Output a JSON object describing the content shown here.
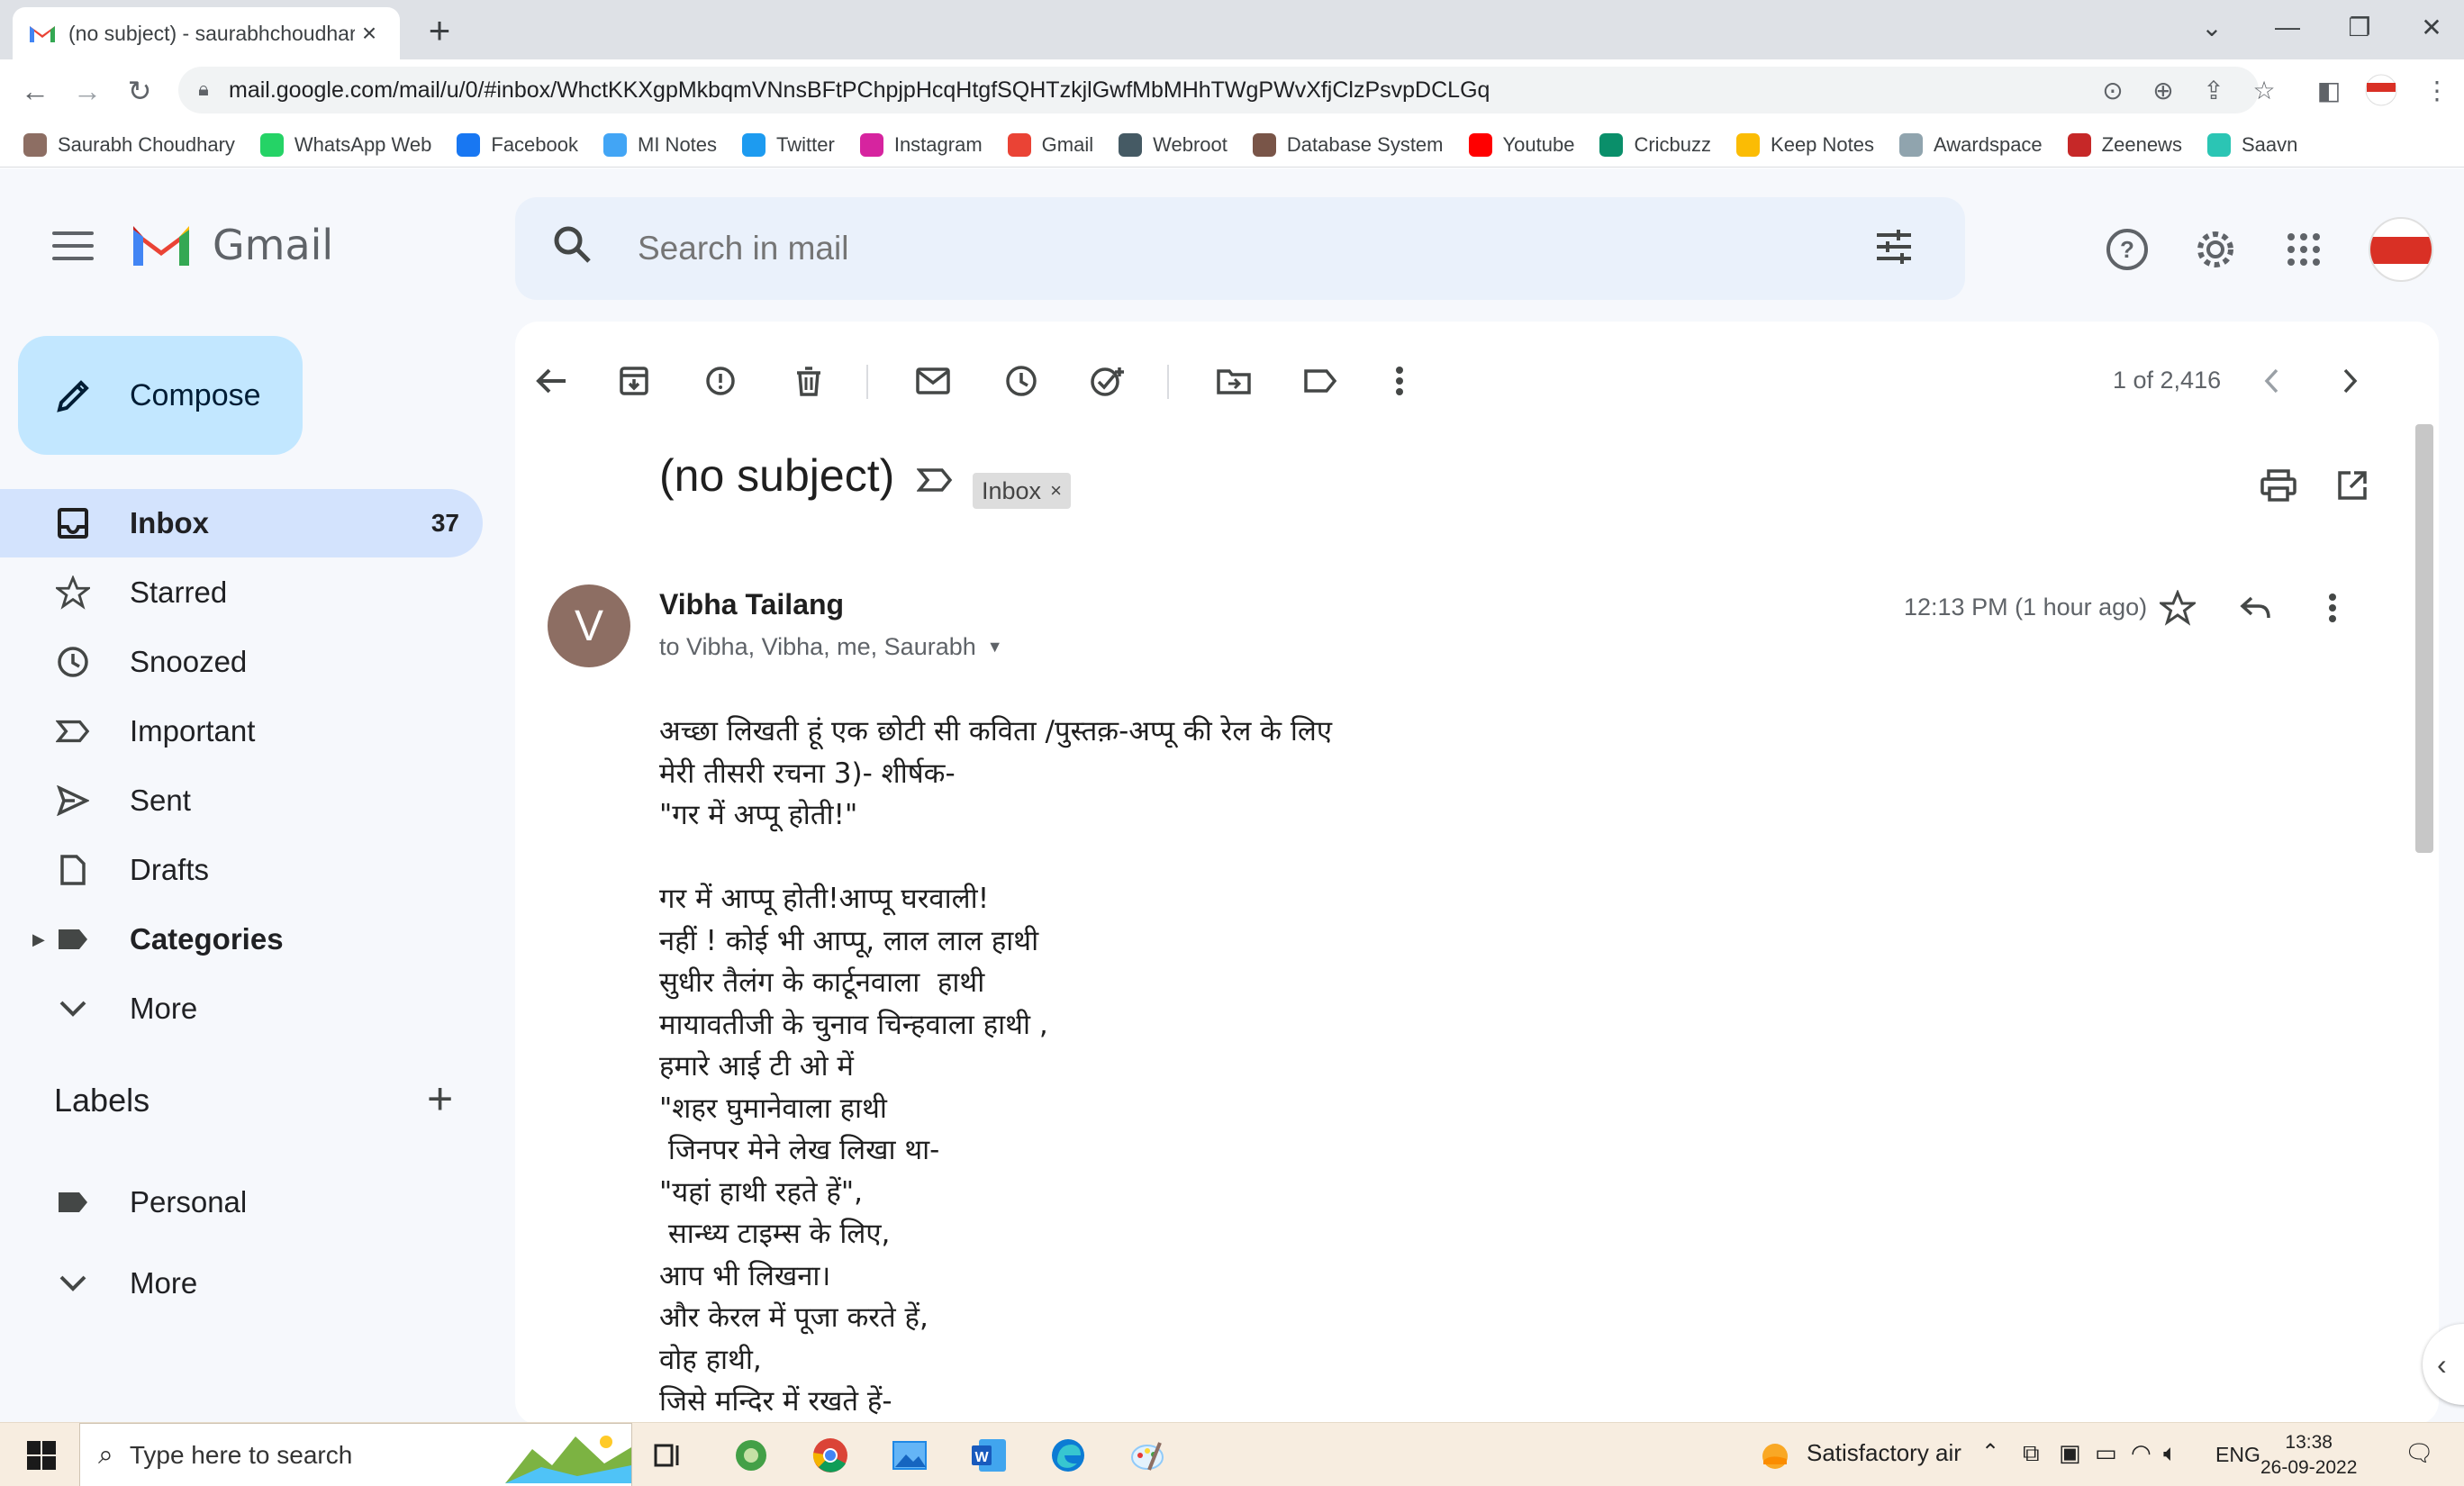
{
  "browser": {
    "tab_title": "(no subject) - saurabhchoudhary",
    "tab_close": "×",
    "new_tab": "+",
    "window_controls": {
      "tabs_menu": "⌄",
      "minimize": "—",
      "restore": "❐",
      "close": "✕"
    },
    "url": "mail.google.com/mail/u/0/#inbox/WhctKKXgpMkbqmVNnsBFtPChpjpHcqHtgfSQHTzkjlGwfMbMHhTWgPWvXfjClzPsvpDCLGq",
    "bookmarks": [
      {
        "label": "Saurabh Choudhary",
        "icon": "profile-icon",
        "color": "#8d6e63"
      },
      {
        "label": "WhatsApp Web",
        "icon": "whatsapp-icon",
        "color": "#25d366"
      },
      {
        "label": "Facebook",
        "icon": "facebook-icon",
        "color": "#1877f2"
      },
      {
        "label": "MI Notes",
        "icon": "notes-icon",
        "color": "#42a5f5"
      },
      {
        "label": "Twitter",
        "icon": "twitter-icon",
        "color": "#1d9bf0"
      },
      {
        "label": "Instagram",
        "icon": "instagram-icon",
        "color": "#d6249f"
      },
      {
        "label": "Gmail",
        "icon": "gmail-icon",
        "color": "#ea4335"
      },
      {
        "label": "Webroot",
        "icon": "webroot-icon",
        "color": "#455a64"
      },
      {
        "label": "Database System",
        "icon": "database-icon",
        "color": "#795548"
      },
      {
        "label": "Youtube",
        "icon": "youtube-icon",
        "color": "#ff0000"
      },
      {
        "label": "Cricbuzz",
        "icon": "cricbuzz-icon",
        "color": "#0a8f6a"
      },
      {
        "label": "Keep Notes",
        "icon": "keep-icon",
        "color": "#fbbc04"
      },
      {
        "label": "Awardspace",
        "icon": "awardspace-icon",
        "color": "#90a4ae"
      },
      {
        "label": "Zeenews",
        "icon": "zeenews-icon",
        "color": "#c62828"
      },
      {
        "label": "Saavn",
        "icon": "saavn-icon",
        "color": "#2bc5b4"
      }
    ]
  },
  "gmail": {
    "brand": "Gmail",
    "search_placeholder": "Search in mail",
    "compose_label": "Compose",
    "nav": [
      {
        "label": "Inbox",
        "count": "37",
        "icon": "inbox-icon",
        "active": true
      },
      {
        "label": "Starred",
        "count": "",
        "icon": "star-icon"
      },
      {
        "label": "Snoozed",
        "count": "",
        "icon": "clock-icon"
      },
      {
        "label": "Important",
        "count": "",
        "icon": "important-icon"
      },
      {
        "label": "Sent",
        "count": "",
        "icon": "send-icon"
      },
      {
        "label": "Drafts",
        "count": "",
        "icon": "draft-icon"
      },
      {
        "label": "Categories",
        "count": "",
        "icon": "label-icon"
      },
      {
        "label": "More",
        "count": "",
        "icon": "chevron-down-icon"
      }
    ],
    "labels_heading": "Labels",
    "labels": [
      {
        "label": "Personal",
        "icon": "label-icon"
      },
      {
        "label": "More",
        "icon": "chevron-down-icon"
      }
    ],
    "pager": "1 of 2,416",
    "message": {
      "subject": "(no subject)",
      "chip": "Inbox",
      "chip_remove": "×",
      "avatar_letter": "V",
      "sender": "Vibha Tailang",
      "recipients": "to Vibha, Vibha, me, Saurabh",
      "time": "12:13 PM (1 hour ago)",
      "body": "अच्छा लिखती हूं एक छोटी सी कविता /पुस्तक़-अप्पू की रेल के लिए\nमेरी तीसरी रचना 3)- शीर्षक-\n\"गर में अप्पू होती!\"\n\nगर में आप्पू होती!आप्पू घरवाली!\nनहीं ! कोई भी आप्पू, लाल लाल हाथी\nसुधीर तैलंग के कार्टूनवाला  हाथी\nमायावतीजी के चुनाव चिन्हवाला हाथी ,\nहमारे आई टी ओ में\n\"शहर घुमानेवाला हाथी\n जिनपर मेने लेख लिखा था-\n\"यहां हाथी रहते हें\",\n सान्ध्य टाइम्स के लिए,\nआप भी लिखना।\nऔर केरल में पूजा करते हें,\nवोह हाथी,\nजिसे मन्दिर में रखते हें-"
    }
  },
  "taskbar": {
    "search_placeholder": "Type here to search",
    "weather": "Satisfactory air",
    "language": "ENG",
    "time": "13:38",
    "date": "26-09-2022"
  },
  "colors": {
    "gmail_bg": "#f6f8fc",
    "active_nav": "#d3e3fd",
    "compose": "#c2e7ff",
    "search_bg": "#eaf1fb",
    "taskbar": "#f7ede0"
  }
}
